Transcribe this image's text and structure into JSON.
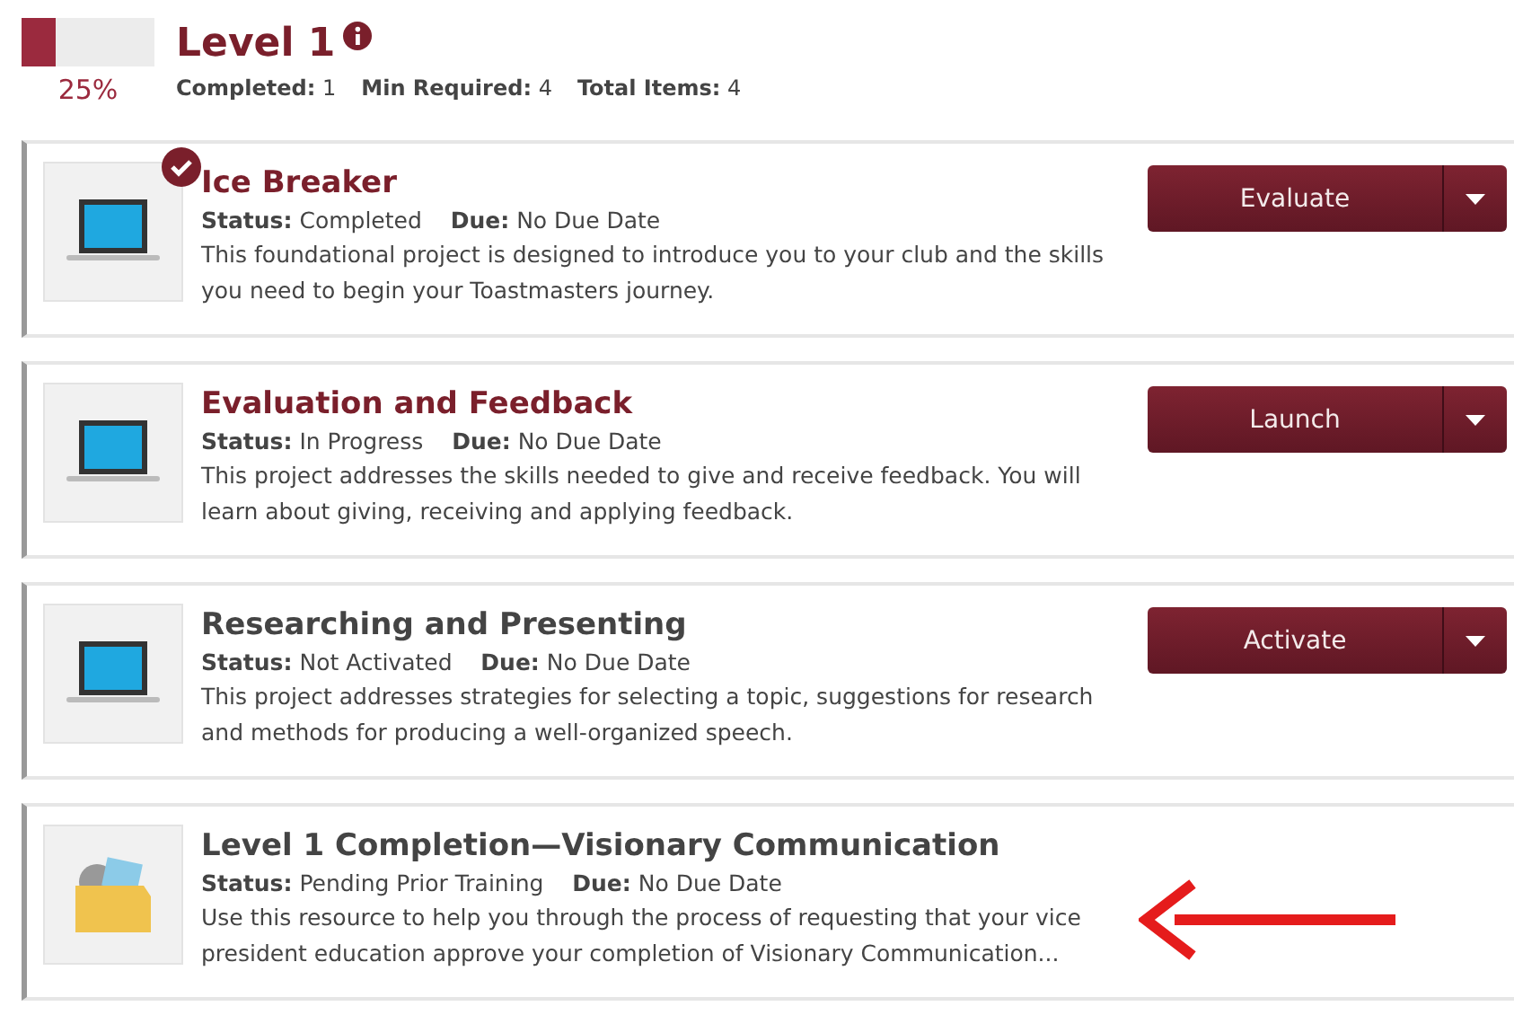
{
  "level": {
    "title": "Level 1",
    "level": 0.25,
    "percent": "25%",
    "stats": [
      {
        "label": "Completed:",
        "value": "1"
      },
      {
        "label": "Min Required:",
        "value": "4"
      },
      {
        "label": "Total Items:",
        "value": "4"
      }
    ]
  },
  "projects": [
    {
      "kind": "laptop",
      "title": "Ice Breaker",
      "highlighted": true,
      "completed": true,
      "status_label": "Status:",
      "status": "Completed",
      "due_label": "Due:",
      "due": "No Due Date",
      "description": "This foundational project is designed to introduce you to your club and the skills you need to begin your Toastmasters journey.",
      "action": "Evaluate",
      "pointer": false
    },
    {
      "kind": "laptop",
      "title": "Evaluation and Feedback",
      "highlighted": true,
      "completed": false,
      "status_label": "Status:",
      "status": "In Progress",
      "due_label": "Due:",
      "due": "No Due Date",
      "description": "This project addresses the skills needed to give and receive feedback. You will learn about giving, receiving and applying feedback.",
      "action": "Launch",
      "pointer": false
    },
    {
      "kind": "laptop",
      "title": "Researching and Presenting",
      "highlighted": false,
      "completed": false,
      "status_label": "Status:",
      "status": "Not Activated",
      "due_label": "Due:",
      "due": "No Due Date",
      "description": "This project addresses strategies for selecting a topic, suggestions for research and methods for producing a well-organized speech.",
      "action": "Activate",
      "pointer": false
    },
    {
      "kind": "folder",
      "title": "Level 1 Completion—Visionary Communication",
      "highlighted": false,
      "completed": false,
      "status_label": "Status:",
      "status": "Pending Prior Training",
      "due_label": "Due:",
      "due": "No Due Date",
      "description": "Use this resource to help you through the process of requesting that your vice president education approve your completion of Visionary Communication...",
      "pointer": true
    }
  ]
}
